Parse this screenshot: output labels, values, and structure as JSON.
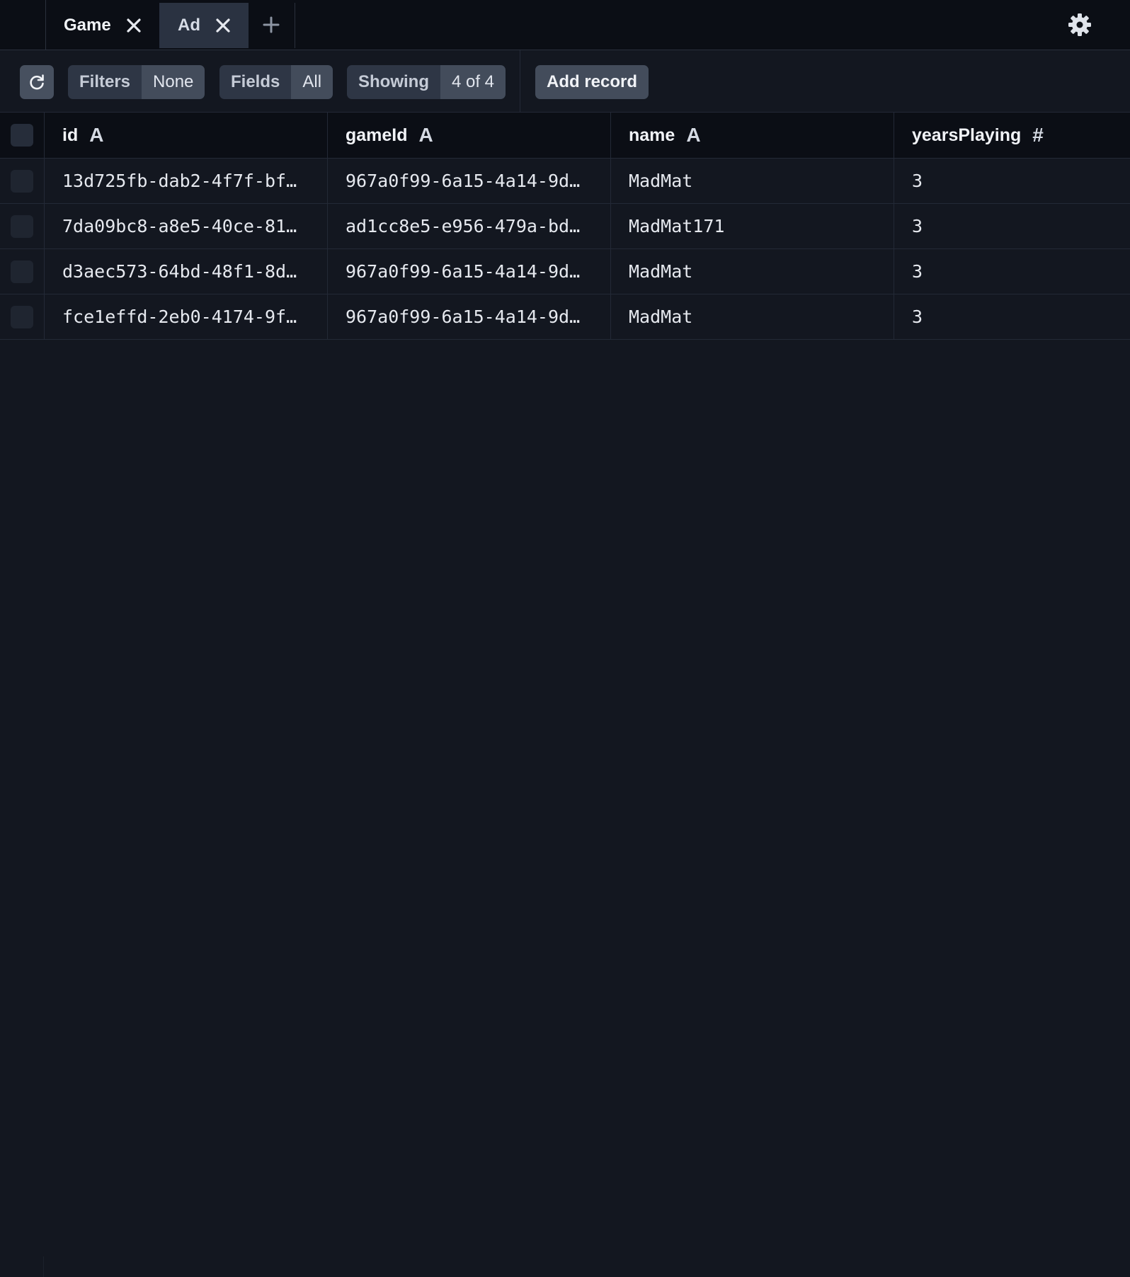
{
  "tabs": [
    {
      "label": "Game"
    },
    {
      "label": "Ad"
    }
  ],
  "toolbar": {
    "filters_label": "Filters",
    "filters_value": "None",
    "fields_label": "Fields",
    "fields_value": "All",
    "showing_label": "Showing",
    "showing_value": "4 of 4",
    "add_record_label": "Add record"
  },
  "table": {
    "columns": [
      {
        "label": "id",
        "type_glyph": "A"
      },
      {
        "label": "gameId",
        "type_glyph": "A"
      },
      {
        "label": "name",
        "type_glyph": "A"
      },
      {
        "label": "yearsPlaying",
        "type_glyph": "#"
      }
    ],
    "rows": [
      {
        "id": "13d725fb-dab2-4f7f-bf…",
        "gameId": "967a0f99-6a15-4a14-9d…",
        "name": "MadMat",
        "yearsPlaying": "3"
      },
      {
        "id": "7da09bc8-a8e5-40ce-81…",
        "gameId": "ad1cc8e5-e956-479a-bd…",
        "name": "MadMat171",
        "yearsPlaying": "3"
      },
      {
        "id": "d3aec573-64bd-48f1-8d…",
        "gameId": "967a0f99-6a15-4a14-9d…",
        "name": "MadMat",
        "yearsPlaying": "3"
      },
      {
        "id": "fce1effd-2eb0-4174-9f…",
        "gameId": "967a0f99-6a15-4a14-9d…",
        "name": "MadMat",
        "yearsPlaying": "3"
      }
    ]
  },
  "icons": {
    "tab_close": "close-icon",
    "tab_add": "plus-icon",
    "settings": "gear-icon",
    "refresh": "refresh-icon"
  },
  "colors": {
    "background": "#131720",
    "tabbar_background": "#0b0e15",
    "active_tab": "#2a3241",
    "button": "#434c5b",
    "pill_key": "#2e3645"
  }
}
